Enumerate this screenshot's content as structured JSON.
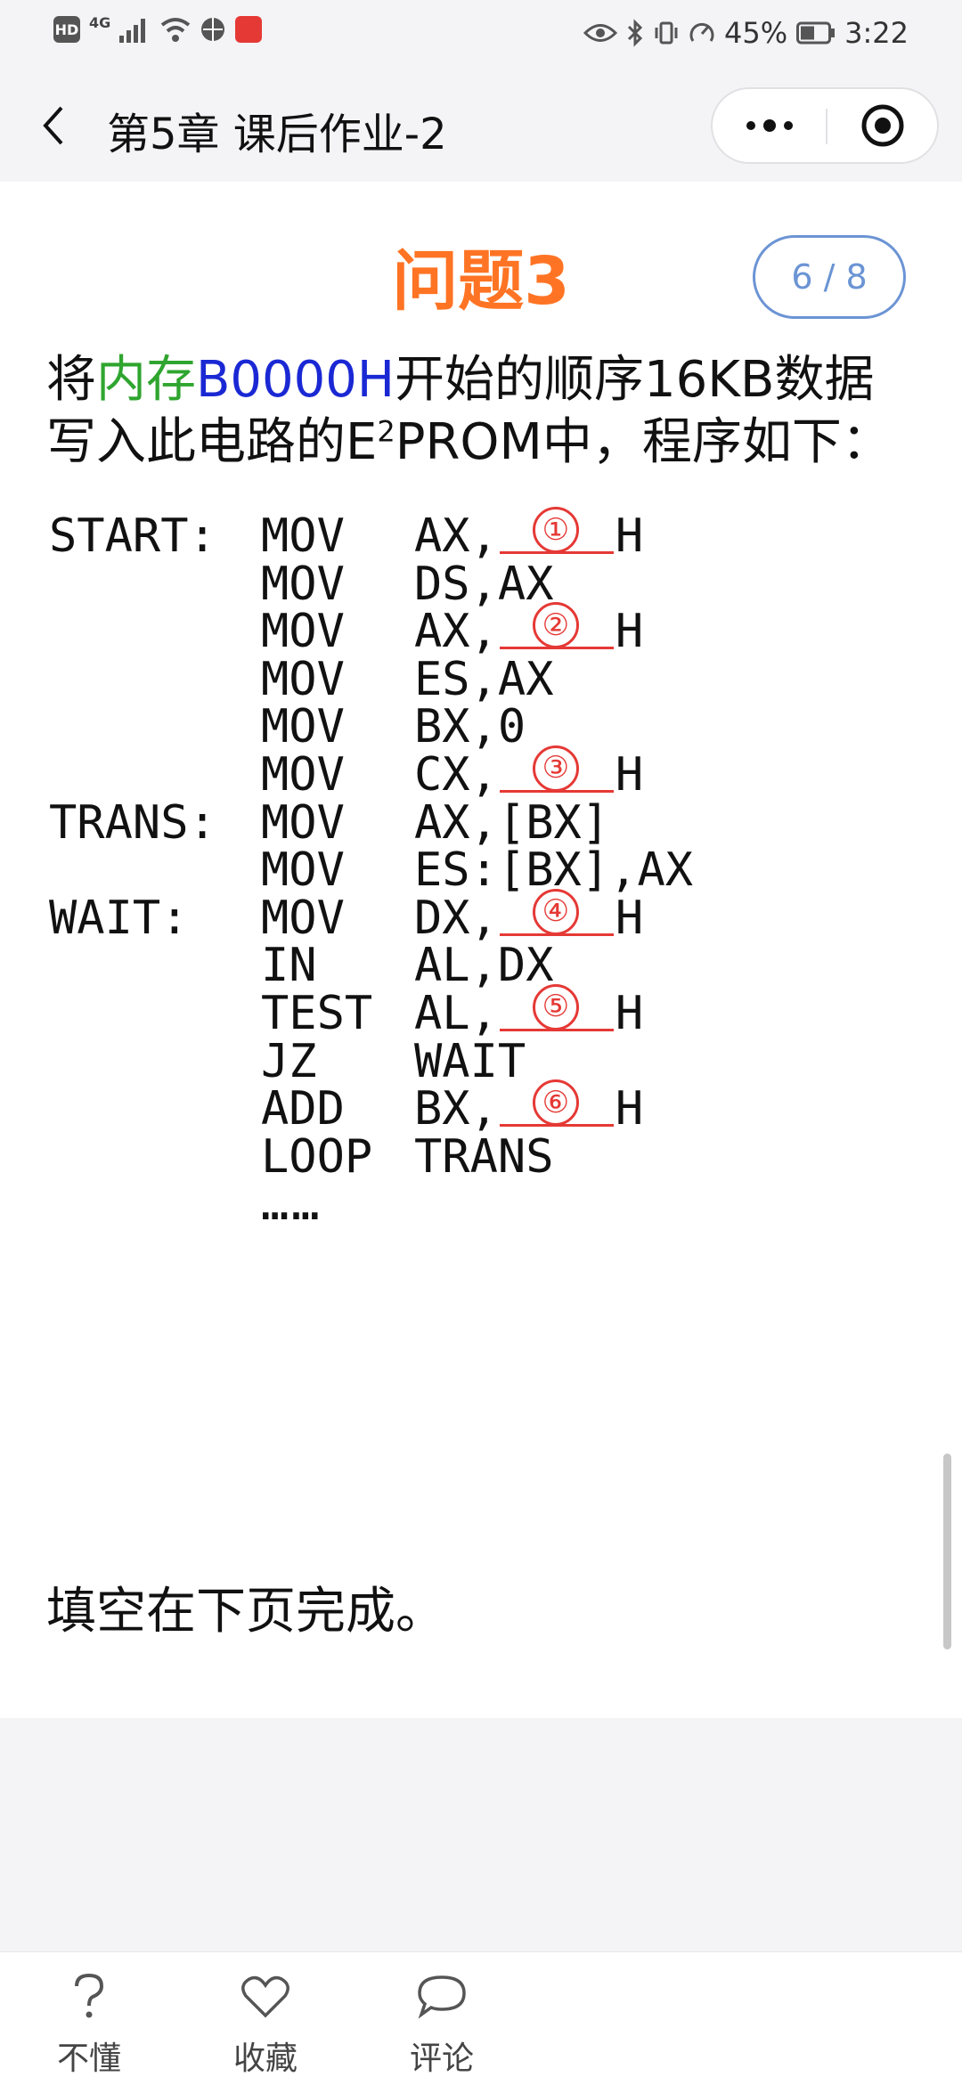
{
  "status_bar": {
    "hd_label": "HD",
    "network_label": "4G",
    "battery_percent": "45%",
    "time": "3:22"
  },
  "nav": {
    "title": "第5章 课后作业-2",
    "back_icon": "back-arrow-icon",
    "more_icon": "more-dots-icon",
    "close_icon": "target-circle-icon"
  },
  "question": {
    "title": "问题3",
    "page_indicator": "6 / 8",
    "text_part1": "将",
    "text_green": "内存",
    "text_blue": "B0000H",
    "text_part2": "开始的顺序16KB数据",
    "text_line2_a": "写入此电路的E",
    "text_line2_sup": "2",
    "text_line2_b": "PROM中，程序如下："
  },
  "code": [
    {
      "label": "START:",
      "op": "MOV",
      "pre": "AX,",
      "blank": "①",
      "post": "H"
    },
    {
      "label": "",
      "op": "MOV",
      "pre": "DS,AX",
      "blank": "",
      "post": ""
    },
    {
      "label": "",
      "op": "MOV",
      "pre": "AX,",
      "blank": "②",
      "post": "H"
    },
    {
      "label": "",
      "op": "MOV",
      "pre": "ES,AX",
      "blank": "",
      "post": ""
    },
    {
      "label": "",
      "op": "MOV",
      "pre": "BX,0",
      "blank": "",
      "post": ""
    },
    {
      "label": "",
      "op": "MOV",
      "pre": "CX,",
      "blank": "③",
      "post": "H"
    },
    {
      "label": "TRANS:",
      "op": "MOV",
      "pre": "AX,[BX]",
      "blank": "",
      "post": ""
    },
    {
      "label": "",
      "op": "MOV",
      "pre": "ES:[BX],AX",
      "blank": "",
      "post": ""
    },
    {
      "label": "WAIT:",
      "op": "MOV",
      "pre": "DX,",
      "blank": "④",
      "post": "H"
    },
    {
      "label": "",
      "op": "IN",
      "pre": "AL,DX",
      "blank": "",
      "post": ""
    },
    {
      "label": "",
      "op": "TEST",
      "pre": "AL,",
      "blank": "⑤",
      "post": "H"
    },
    {
      "label": "",
      "op": "JZ",
      "pre": "WAIT",
      "blank": "",
      "post": ""
    },
    {
      "label": "",
      "op": "ADD",
      "pre": "BX,",
      "blank": "⑥",
      "post": "H"
    },
    {
      "label": "",
      "op": "LOOP",
      "pre": "TRANS",
      "blank": "",
      "post": ""
    }
  ],
  "code_ellipsis": "……",
  "footer_text": "填空在下页完成。",
  "bottom_bar": {
    "items": [
      {
        "label": "不懂",
        "icon": "question-mark-icon"
      },
      {
        "label": "收藏",
        "icon": "heart-icon"
      },
      {
        "label": "评论",
        "icon": "comment-bubble-icon"
      }
    ]
  },
  "colors": {
    "title_orange": "#ff7424",
    "badge_blue": "#6b94d4",
    "blank_red": "#e53935",
    "highlight_green": "#2fa52f",
    "highlight_blue": "#1a28d4"
  }
}
